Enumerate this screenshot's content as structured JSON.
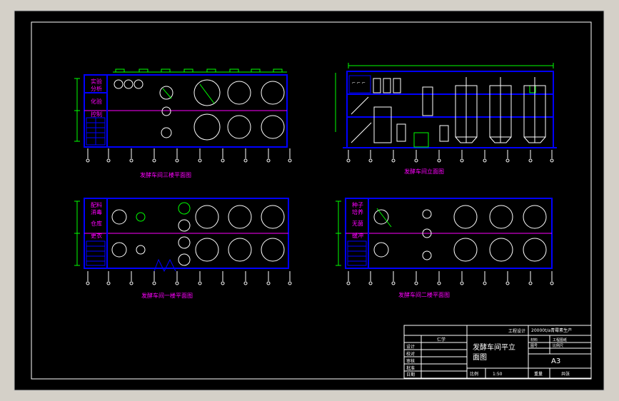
{
  "drawing": {
    "views": [
      {
        "id": "third-floor",
        "title": "发酵车间三楼平面图"
      },
      {
        "id": "elevation",
        "title": "发酵车间立面图"
      },
      {
        "id": "first-floor",
        "title": "发酵车间一楼平面图"
      },
      {
        "id": "second-floor",
        "title": "发酵车间二楼平面图"
      }
    ],
    "title_block": {
      "project": "20000t/a青霉素生产",
      "designer_tag": "工程设计",
      "drawing_title_line1": "发酵车间平立",
      "drawing_title_line2": "面图",
      "school_label": "仁学",
      "sheet_size": "A3",
      "scale_label": "比例",
      "scale_value": "1:50",
      "r_design": "设计",
      "r_check": "校对",
      "r_review": "审核",
      "r_approve": "批准",
      "r_date": "日期",
      "cell_a": "材料",
      "cell_b": "工程图纸",
      "cell_c": "图号",
      "cell_d": "比例尺",
      "weight": "重量",
      "total": "共张"
    }
  },
  "colors": {
    "background": "#000000",
    "frame": "#ffffff",
    "wall": "#0000ff",
    "equipment": "#ffffff",
    "grid": "#ff00ff",
    "dimension": "#00ff00",
    "axis": "#ffffff",
    "label": "#ff00ff"
  }
}
